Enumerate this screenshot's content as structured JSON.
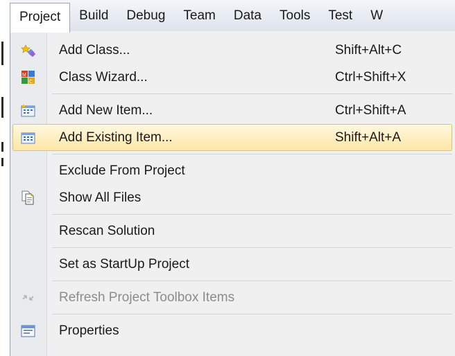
{
  "menubar": {
    "items": [
      {
        "label": "Project"
      },
      {
        "label": "Build"
      },
      {
        "label": "Debug"
      },
      {
        "label": "Team"
      },
      {
        "label": "Data"
      },
      {
        "label": "Tools"
      },
      {
        "label": "Test"
      },
      {
        "label": "W"
      }
    ]
  },
  "menu": {
    "items": [
      {
        "label": "Add Class...",
        "shortcut": "Shift+Alt+C",
        "icon": "add-class-icon"
      },
      {
        "label": "Class Wizard...",
        "shortcut": "Ctrl+Shift+X",
        "icon": "class-wizard-icon"
      },
      {
        "label": "Add New Item...",
        "shortcut": "Ctrl+Shift+A",
        "icon": "add-new-item-icon"
      },
      {
        "label": "Add Existing Item...",
        "shortcut": "Shift+Alt+A",
        "icon": "add-existing-item-icon"
      },
      {
        "label": "Exclude From Project",
        "shortcut": ""
      },
      {
        "label": "Show All Files",
        "shortcut": "",
        "icon": "show-all-files-icon"
      },
      {
        "label": "Rescan Solution",
        "shortcut": ""
      },
      {
        "label": "Set as StartUp Project",
        "shortcut": ""
      },
      {
        "label": "Refresh Project Toolbox Items",
        "shortcut": "",
        "icon": "refresh-toolbox-icon",
        "disabled": true
      },
      {
        "label": "Properties",
        "shortcut": "",
        "icon": "properties-icon"
      }
    ]
  },
  "colors": {
    "highlight": "#fde7a6",
    "disabled_text": "#8c8c8c"
  }
}
